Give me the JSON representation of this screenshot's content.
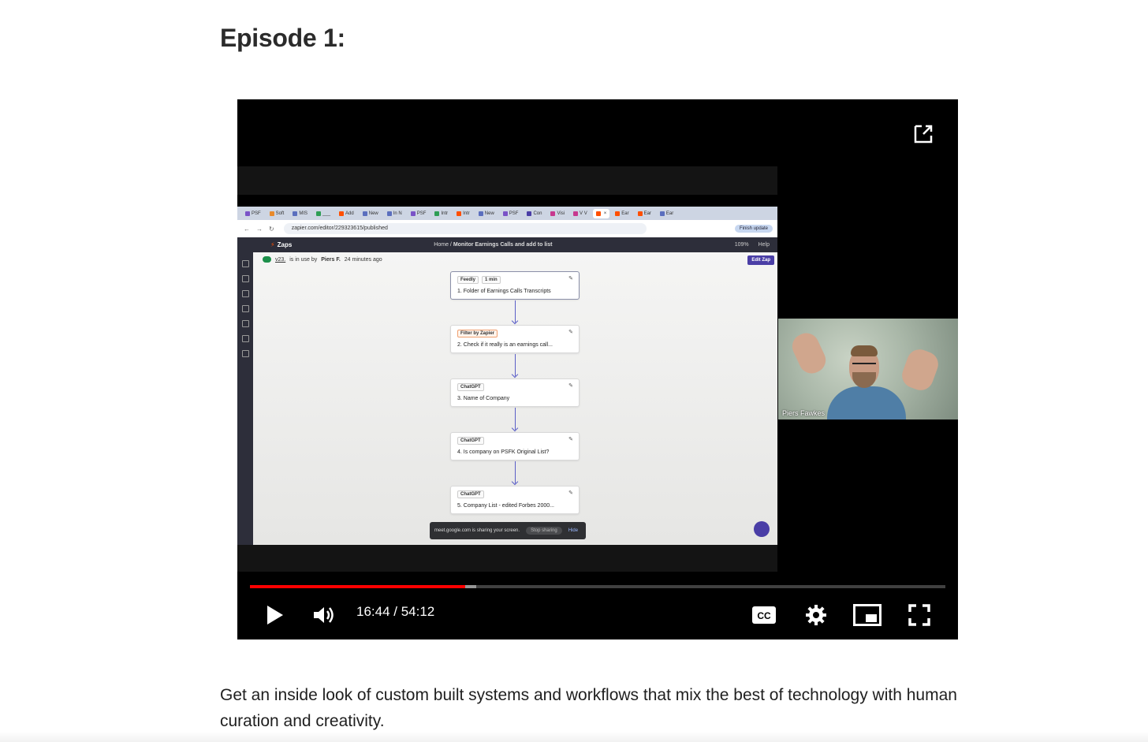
{
  "heading": "Episode 1:",
  "video": {
    "current_time": "16:44",
    "separator": " / ",
    "duration": "54:12",
    "progress_played": 0.31,
    "progress_buffered": 0.325,
    "participant_name": "Piers Fawkes",
    "colors": {
      "progress": "#ff0000",
      "background": "#000000"
    },
    "controls": {
      "play": "play-icon",
      "volume": "volume-icon",
      "captions": "closed-captions-icon",
      "settings": "gear-icon",
      "miniplayer": "miniplayer-icon",
      "fullscreen": "fullscreen-icon",
      "share": "open-external-icon"
    }
  },
  "screen_share": {
    "tabs": [
      "PSF",
      "Soft",
      "MIS",
      "___",
      "Add",
      "New",
      "In N",
      "PSF",
      "Intr",
      "Intr",
      "New",
      "PSF",
      "Con",
      "Visi",
      "V V",
      "",
      "Ear",
      "Ear",
      "Ear"
    ],
    "url": "zapier.com/editor/229323615/published",
    "finish_update": "Finish update",
    "app_name": "Zaps",
    "breadcrumb_home": "Home",
    "breadcrumb_zap": "Monitor Earnings Calls and add to list",
    "zoom": "109%",
    "help": "Help",
    "status_version": "v23.",
    "status_text": "is in use by",
    "status_user": "Piers F.",
    "status_time": "24 minutes ago",
    "edit_zap": "Edit Zap",
    "steps": [
      {
        "app": "Feedly",
        "badge": "1 min",
        "title": "1. Folder of Earnings Calls Transcripts"
      },
      {
        "app": "Filter by Zapier",
        "badge": "",
        "title": "2. Check if it really is an earnings call..."
      },
      {
        "app": "ChatGPT",
        "badge": "",
        "title": "3. Name of Company"
      },
      {
        "app": "ChatGPT",
        "badge": "",
        "title": "4. Is company on PSFK Original List?"
      },
      {
        "app": "ChatGPT",
        "badge": "",
        "title": "5. Company List - edited Forbes 2000..."
      }
    ],
    "sharing_notice": "meet.google.com is sharing your screen.",
    "stop_sharing": "Stop sharing",
    "hide": "Hide"
  },
  "description": "Get an inside look of custom built systems and workflows that mix the best of technology with human curation and creativity."
}
